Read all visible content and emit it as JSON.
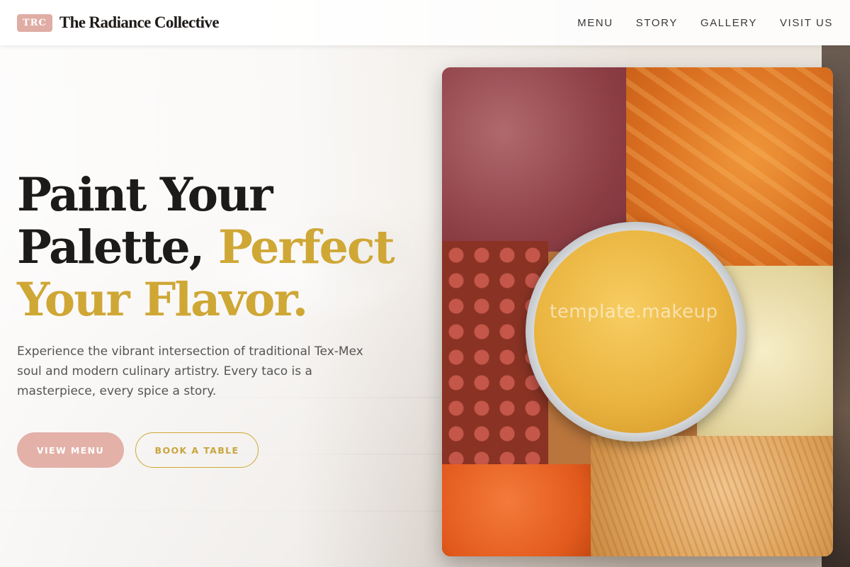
{
  "brand": {
    "badge": "TRC",
    "name": "The Radiance Collective"
  },
  "nav": {
    "items": [
      "MENU",
      "STORY",
      "GALLERY",
      "VISIT US"
    ]
  },
  "hero": {
    "headline_line1": "Paint Your",
    "headline_line2_dark": "Palette,",
    "headline_line2_gold": "Perfect",
    "headline_line3_gold": "Your Flavor.",
    "lead": "Experience the vibrant intersection of traditional Tex-Mex soul and modern culinary artistry. Every taco is a masterpiece, every spice a story.",
    "primary_cta": "VIEW MENU",
    "secondary_cta": "BOOK A TABLE"
  },
  "image": {
    "watermark": "template.makeup"
  },
  "colors": {
    "accent_gold": "#cfa735",
    "accent_pink": "#e3b1a8",
    "text_dark": "#1d1b1a"
  }
}
